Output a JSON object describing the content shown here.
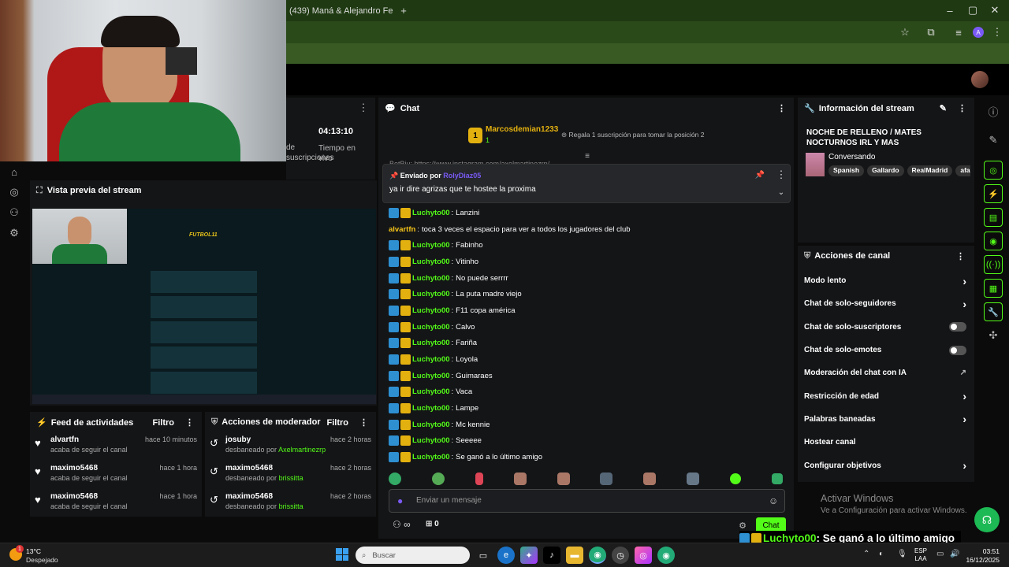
{
  "browser": {
    "tab_title": "(439) Maná & Alejandro Fe",
    "new_tab": "+",
    "window_controls": [
      "–",
      "▢",
      "✕"
    ],
    "profile_initial": "A"
  },
  "stats": {
    "sub_label": "de suscripciones",
    "time_value": "04:13:10",
    "time_label": "Tiempo en vivo"
  },
  "preview": {
    "title": "Vista previa del stream",
    "game_title": "FUTBOL11"
  },
  "activity_feed": {
    "title": "Feed de actividades",
    "filter": "Filtro",
    "items": [
      {
        "user": "alvartfn",
        "action": "acaba de seguir el canal",
        "time": "hace 10 minutos"
      },
      {
        "user": "maximo5468",
        "action": "acaba de seguir el canal",
        "time": "hace 1 hora"
      },
      {
        "user": "maximo5468",
        "action": "acaba de seguir el canal",
        "time": "hace 1 hora"
      }
    ]
  },
  "mod_actions": {
    "title": "Acciones de moderador",
    "filter": "Filtro",
    "items": [
      {
        "user": "josuby",
        "action_prefix": "desbaneado por",
        "by": "Axelmartinezrp",
        "time": "hace 2 horas"
      },
      {
        "user": "maximo5468",
        "action_prefix": "desbaneado por",
        "by": "brissitta",
        "time": "hace 2 horas"
      },
      {
        "user": "maximo5468",
        "action_prefix": "desbaneado por",
        "by": "brissitta",
        "time": "hace 2 horas"
      }
    ]
  },
  "chat": {
    "title": "Chat",
    "top_gifter": "Marcosdemian1233",
    "top_gifter_count": "1",
    "gift_prompt": "Regala 1 suscripción para tomar la posición 2",
    "hidden_line": "BetBiu: https://www.instagram.com/axelmartinezrp/",
    "pinned": {
      "label": "Enviado por",
      "by": "RolyDiaz05",
      "text": "ya ir dire agrizas que te hostee la proxima"
    },
    "messages": [
      {
        "user": "Luchyto00",
        "text": "Lanzini",
        "badges": true
      },
      {
        "user": "alvartfn",
        "text": "toca 3 veces el espacio para ver a todos los jugadores del club",
        "badges": false
      },
      {
        "user": "Luchyto00",
        "text": "Fabinho",
        "badges": true
      },
      {
        "user": "Luchyto00",
        "text": "Vitinho",
        "badges": true
      },
      {
        "user": "Luchyto00",
        "text": "No puede serrrr",
        "badges": true
      },
      {
        "user": "Luchyto00",
        "text": "La puta madre viejo",
        "badges": true
      },
      {
        "user": "Luchyto00",
        "text": "F11 copa américa",
        "badges": true
      },
      {
        "user": "Luchyto00",
        "text": "Calvo",
        "badges": true
      },
      {
        "user": "Luchyto00",
        "text": "Fariña",
        "badges": true
      },
      {
        "user": "Luchyto00",
        "text": "Loyola",
        "badges": true
      },
      {
        "user": "Luchyto00",
        "text": "Guimaraes",
        "badges": true
      },
      {
        "user": "Luchyto00",
        "text": "Vaca",
        "badges": true
      },
      {
        "user": "Luchyto00",
        "text": "Lampe",
        "badges": true
      },
      {
        "user": "Luchyto00",
        "text": "Mc kennie",
        "badges": true
      },
      {
        "user": "Luchyto00",
        "text": "Seeeee",
        "badges": true
      },
      {
        "user": "Luchyto00",
        "text": "Se ganó a lo último amigo",
        "badges": true
      }
    ],
    "input_placeholder": "Enviar un mensaje",
    "infinity": "∞",
    "gift_count": "0",
    "send_button": "Chat"
  },
  "stream_info": {
    "title": "Información del stream",
    "stream_title": "NOCHE DE RELLENO / MATES NOCTURNOS IRL Y MAS",
    "category": "Conversando",
    "tags": [
      "Spanish",
      "Gallardo",
      "RealMadrid",
      "afa"
    ]
  },
  "channel_actions": {
    "title": "Acciones de canal",
    "items": [
      {
        "label": "Modo lento",
        "control": "chevron"
      },
      {
        "label": "Chat de solo-seguidores",
        "control": "chevron"
      },
      {
        "label": "Chat de solo-suscriptores",
        "control": "toggle"
      },
      {
        "label": "Chat de solo-emotes",
        "control": "toggle"
      },
      {
        "label": "Moderación del chat con IA",
        "control": "external"
      },
      {
        "label": "Restricción de edad",
        "control": "chevron"
      },
      {
        "label": "Palabras baneadas",
        "control": "chevron"
      },
      {
        "label": "Hostear canal",
        "control": "none"
      },
      {
        "label": "Configurar objetivos",
        "control": "chevron"
      }
    ]
  },
  "windows_watermark": {
    "line1": "Activar Windows",
    "line2": "Ve a Configuración para activar Windows."
  },
  "overlay_message": {
    "user": "Luchyto00",
    "text": ": Se ganó a lo último amigo"
  },
  "taskbar": {
    "weather_temp": "13°C",
    "weather_desc": "Despejado",
    "weather_badge": "1",
    "search_placeholder": "Buscar",
    "lang_line1": "ESP",
    "lang_line2": "LAA",
    "time": "03:51",
    "date": "16/12/2025"
  },
  "colors": {
    "kick_green": "#53fc18",
    "panel_bg": "#141517",
    "browser_green": "#2b4a1a"
  }
}
